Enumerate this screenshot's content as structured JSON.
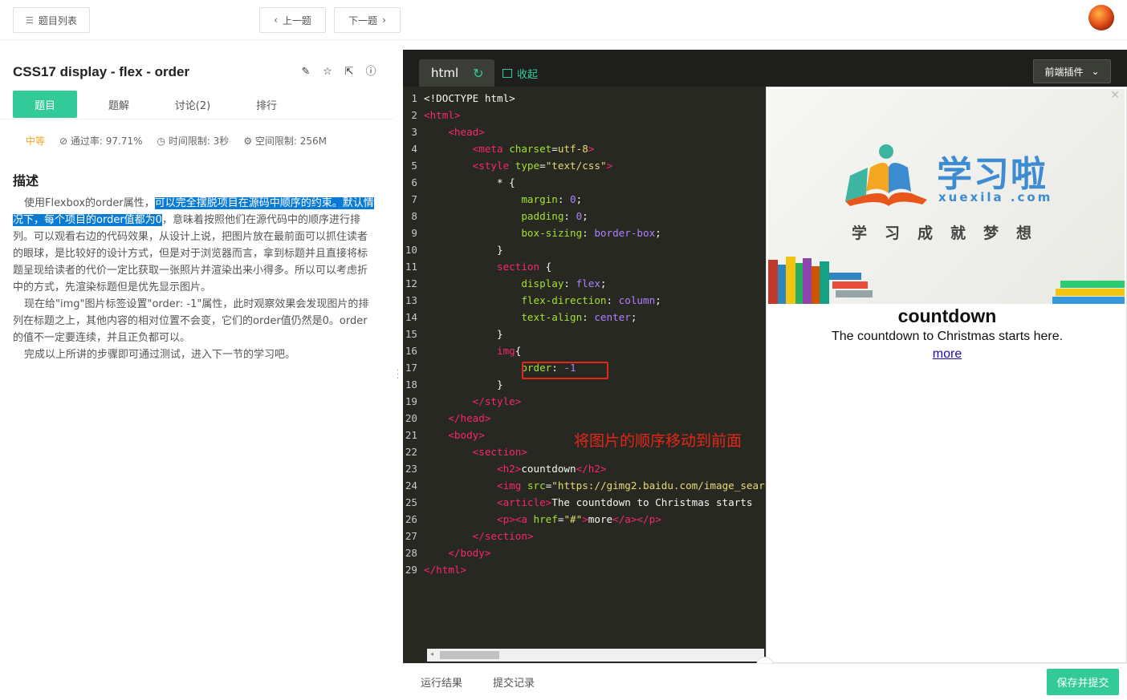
{
  "topbar": {
    "list_label": "题目列表",
    "prev_label": "上一题",
    "next_label": "下一题"
  },
  "question": {
    "title": "CSS17  display - flex - order",
    "tabs": [
      "题目",
      "题解",
      "讨论(2)",
      "排行"
    ],
    "difficulty": "中等",
    "pass_rate": "通过率: 97.71%",
    "time_limit": "时间限制: 3秒",
    "space_limit": "空间限制: 256M",
    "desc_heading": "描述",
    "desc_p1_a": "使用Flexbox的order属性，",
    "desc_p1_hl": "可以完全摆脱项目在源码中顺序的约束。默认情况下，每个项目的order值都为0",
    "desc_p1_b": "，意味着按照他们在源代码中的顺序进行排列。可以观看右边的代码效果，从设计上说，把图片放在最前面可以抓住读者的眼球，是比较好的设计方式，但是对于浏览器而言，拿到标题并且直接将标题呈现给读者的代价一定比获取一张照片并渲染出来小得多。所以可以考虑折中的方式，先渲染标题但是优先显示图片。",
    "desc_p2": "现在给\"img\"图片标签设置\"order: -1\"属性，此时观察效果会发现图片的排列在标题之上，其他内容的相对位置不会变，它们的order值仍然是0。order的值不一定要连续，并且正负都可以。",
    "desc_p3": "完成以上所讲的步骤即可通过测试，进入下一节的学习吧。"
  },
  "editor": {
    "tab_label": "html",
    "collapse_label": "收起",
    "plugin_label": "前端插件",
    "annotation": "将图片的顺序移动到前面"
  },
  "preview": {
    "logo_cn": "学习啦",
    "logo_en": "xuexila .com",
    "slogan": "学习成就梦想",
    "h2": "countdown",
    "article": "The countdown to Christmas starts here.",
    "link": "more"
  },
  "bottom": {
    "run_result": "运行结果",
    "submit_record": "提交记录",
    "submit_label": "保存并提交"
  },
  "colors": {
    "accent": "#32ca99",
    "editor_bg": "#272822",
    "highlight": "#0a7bd5",
    "annotation_red": "#e5261a"
  }
}
